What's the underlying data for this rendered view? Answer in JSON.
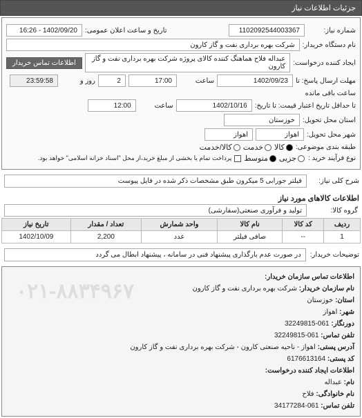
{
  "header": {
    "title": "جزئیات اطلاعات نیاز"
  },
  "fields": {
    "need_no_label": "شماره نیاز:",
    "need_no": "1102092544003367",
    "announce_label": "تاریخ و ساعت اعلان عمومی:",
    "announce_val": "1402/09/20 - 16:26",
    "buyer_org_label": "نام دستگاه خریدار:",
    "buyer_org": "شرکت بهره برداری نفت و گاز کارون",
    "creator_label": "ایجاد کننده درخواست:",
    "creator": "عبداله فلاح هماهنگ کننده کالای پروژه شرکت بهره برداری نفت و گاز کارون",
    "contact_btn": "اطلاعات تماس خریدار",
    "deadline_label": "مهلت ارسال پاسخ: تا",
    "deadline_date": "1402/09/23",
    "time_label": "ساعت",
    "deadline_time": "17:00",
    "validity_label": "تا حداقل تاریخ اعتبار قیمت: تا تاریخ:",
    "validity_date": "1402/10/16",
    "validity_time": "12:00",
    "day_label": "روز و",
    "day_val": "2",
    "remain_label": "ساعت باقی مانده",
    "remain_time": "23:59:58",
    "province_label": "استان محل تحویل:",
    "province": "خوزستان",
    "city_label": "شهر محل تحویل:",
    "city": "اهواز",
    "city2": "اهواز",
    "class_label": "طبقه بندی موضوعی:",
    "class_goods": "کالا",
    "class_service": "خدمت",
    "class_both": "کالا/خدمت",
    "buy_type_label": "نوع فرآیند خرید :",
    "buy_minor": "جزیی",
    "buy_medium": "متوسط",
    "buy_note": "پرداخت تمام یا بخشی از مبلغ خرید،از محل \"اسناد خزانه اسلامی\" خواهد بود.",
    "desc_label": "شرح کلی نیاز:",
    "desc_val": "فیلتر جورابی 5 میکرون طبق مشخصات ذکر شده در فایل پیوست",
    "items_title": "اطلاعات کالاهای مورد نیاز",
    "group_label": "گروه کالا:",
    "group_val": "تولید و فرآوری صنعتی(سفارشی)",
    "buyer_note_label": "توضیحات خریدار:",
    "buyer_note": "در صورت عدم بارگذاری پیشنهاد فنی در سامانه ، پیشنهاد ابطال می گردد"
  },
  "table": {
    "headers": [
      "ردیف",
      "کد کالا",
      "نام کالا",
      "واحد شمارش",
      "تعداد / مقدار",
      "تاریخ نیاز"
    ],
    "rows": [
      {
        "idx": "1",
        "code": "--",
        "name": "صافی فیلتر",
        "unit": "عدد",
        "qty": "2,200",
        "date": "1402/10/09"
      }
    ]
  },
  "footer": {
    "title": "اطلاعات تماس سازمان خریدار:",
    "org_label": "نام سازمان خریدار:",
    "org": "شرکت بهره برداری نفت و گاز کارون",
    "prov_label": "استان:",
    "prov": "خوزستان",
    "city_label": "شهر:",
    "city": "اهواز",
    "fax_label": "دورنگار:",
    "fax": "061-32249815",
    "tel_label": "تلفن تماس:",
    "tel": "061-32249815",
    "addr_label": "آدرس پستی:",
    "addr": "اهواز - ناحیه صنعتی کارون - شرکت بهره برداری نفت و گاز کارون",
    "post_label": "کد پستی:",
    "post": "6176613164",
    "req_title": "اطلاعات ایجاد کننده درخواست:",
    "name_label": "نام:",
    "name": "عبداله",
    "family_label": "نام خانوادگی:",
    "family": "فلاح",
    "req_tel_label": "تلفن تماس:",
    "req_tel": "061-34177284",
    "watermark": "۰۲۱-۸۸۳۴۹۶۷"
  }
}
